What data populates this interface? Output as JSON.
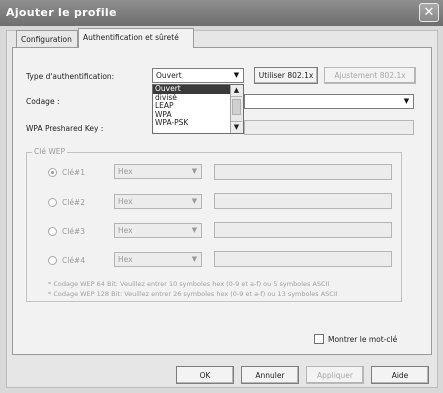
{
  "window": {
    "title": "Ajouter le profile",
    "close_glyph": "✕"
  },
  "tabs": [
    {
      "label": "Configuration",
      "active": false
    },
    {
      "label": "Authentification et sûreté",
      "active": true
    }
  ],
  "auth": {
    "label": "Type d'authentification:",
    "value": "Ouvert",
    "options": [
      "Ouvert",
      "divisé",
      "LEAP",
      "WPA",
      "WPA-PSK"
    ],
    "selected_index": 0
  },
  "buttons": {
    "use_8021x": "Utiliser 802.1x",
    "adjust_8021x": "Ajustement 802.1x",
    "ok": "OK",
    "cancel": "Annuler",
    "apply": "Appliquer",
    "help": "Aide"
  },
  "encoding": {
    "label": "Codage :",
    "value": ""
  },
  "wpa": {
    "label": "WPA Preshared Key :",
    "value": ""
  },
  "wep": {
    "group_label": "Clé WEP",
    "keys": [
      {
        "label": "Clé#1",
        "format": "Hex",
        "value": "",
        "selected": true
      },
      {
        "label": "Clé#2",
        "format": "Hex",
        "value": "",
        "selected": false
      },
      {
        "label": "Clé#3",
        "format": "Hex",
        "value": "",
        "selected": false
      },
      {
        "label": "Clé#4",
        "format": "Hex",
        "value": "",
        "selected": false
      }
    ],
    "note_64": "* Codage WEP 64 Bit: Veuillez entrer 10 symboles hex (0-9 et a-f) ou 5 symboles ASCII",
    "note_128": "* Codage WEP 128 Bit: Veuillez entrer 26 symboles hex (0-9 et a-f) ou 13 symboles ASCII"
  },
  "show_key": {
    "label": "Montrer le mot-clé",
    "checked": false
  },
  "icons": {
    "dropdown": "▼",
    "scroll_up": "▲",
    "scroll_down": "▼"
  }
}
